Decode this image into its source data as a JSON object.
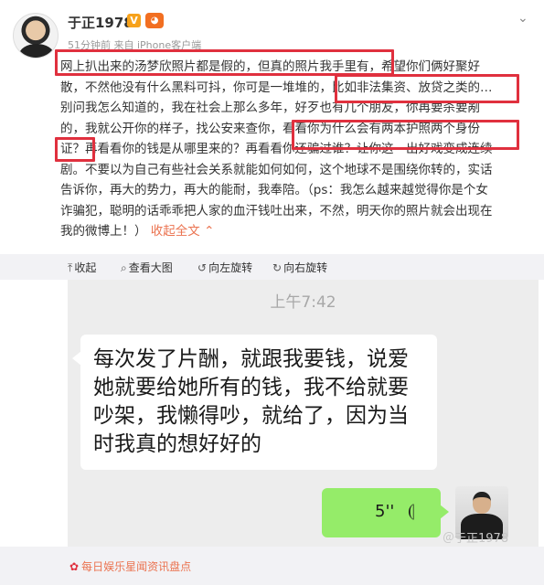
{
  "post": {
    "username": "于正1978",
    "verified_badge": "V",
    "vip_badge": "๑",
    "time_source": "51分钟前 来自 iPhone客户端",
    "lines": [
      "网上扒出来的汤梦欣照片都是假的，但真的照片我手里有，希望你们俩好聚好",
      "散，不然他没有什么黑料可抖，你可是一堆堆的，比如非法集资、放贷之类的…",
      "别问我怎么知道的，我在社会上那么多年，好歹也有几个朋友，你再要杀要剐",
      "的，我就公开你的样子，找公安来查你，看看你为什么会有两本护照两个身份",
      "证？再看看你的钱是从哪里来的？再看看你还骗过谁？让你这一出好戏变成连续",
      "剧。不要以为自己有些社会关系就能如何如何，这个地球不是围绕你转的，实话",
      "告诉你，再大的势力，再大的能耐，我奉陪。（ps：我怎么越来越觉得你是个女",
      "诈骗犯，聪明的话乖乖把人家的血汗钱吐出来，不然，明天你的照片就会出现在"
    ],
    "last_line": "我的微博上！）",
    "collapse_link": "收起全文",
    "collapse_icon": "up-caret-icon"
  },
  "toolbar": {
    "collapse": "收起",
    "view_large": "查看大图",
    "rotate_left": "向左旋转",
    "rotate_right": "向右旋转"
  },
  "chat": {
    "time": "上午7:42",
    "message": "每次发了片酬，就跟我要钱，说爱她就要给她所有的钱，我不给就要吵架，我懒得吵，就给了，因为当时我真的想好好的",
    "voice_duration": "5''",
    "bubble_color": "#ffffff",
    "voice_color": "#95ec69"
  },
  "watermark": "＠于正1978",
  "source": "每日娱乐星闻资讯盘点",
  "highlight_color": "#e0303e",
  "link_color": "#eb7350"
}
